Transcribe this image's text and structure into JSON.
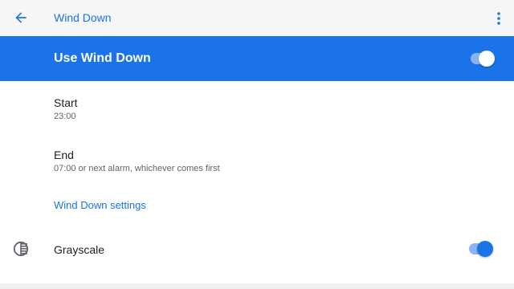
{
  "header": {
    "title": "Wind Down",
    "back_icon": "arrow-back-icon",
    "menu_icon": "more-vert-icon"
  },
  "master": {
    "label": "Use Wind Down",
    "enabled": true
  },
  "settings": {
    "start": {
      "title": "Start",
      "summary": "23:00"
    },
    "end": {
      "title": "End",
      "summary": "07:00 or next alarm, whichever comes first"
    },
    "more_link": "Wind Down settings",
    "grayscale": {
      "label": "Grayscale",
      "icon": "grayscale-icon",
      "enabled": true
    }
  },
  "colors": {
    "accent": "#1a73e8",
    "accent_light": "#8ab4f8",
    "app_bar": "#f6f6f6"
  }
}
